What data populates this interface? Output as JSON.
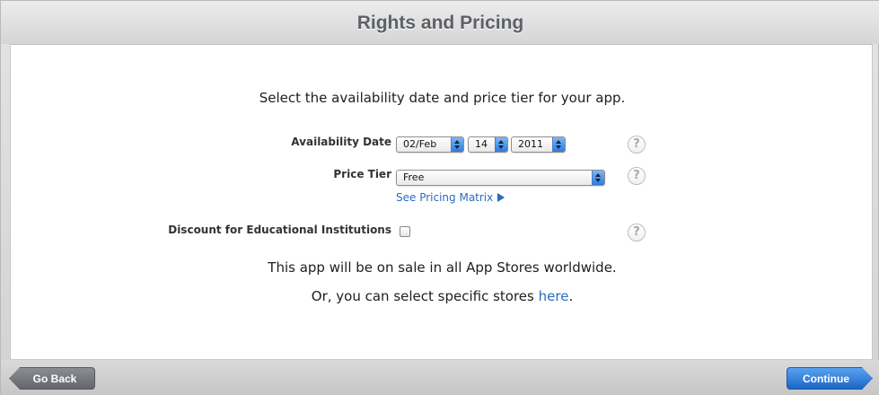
{
  "header": {
    "title": "Rights and Pricing"
  },
  "main": {
    "intro": "Select the availability date and price tier for your app.",
    "availability": {
      "label": "Availability Date",
      "month": "02/Feb",
      "day": "14",
      "year": "2011"
    },
    "price_tier": {
      "label": "Price Tier",
      "value": "Free",
      "matrix_link": "See Pricing Matrix"
    },
    "discount": {
      "label": "Discount for Educational Institutions",
      "checked": false
    },
    "help_glyph": "?",
    "sale_text": "This app will be on sale in all App Stores worldwide.",
    "stores_prefix": "Or, you can select specific stores ",
    "stores_link": "here",
    "stores_suffix": "."
  },
  "footer": {
    "back_label": "Go Back",
    "continue_label": "Continue"
  },
  "colors": {
    "link": "#2a6cc0",
    "continue_button": "#1a66c6",
    "back_button": "#62666c"
  },
  "icons": {
    "help": "question-mark-circle-icon",
    "select": "up-down-arrows-icon",
    "matrix": "right-triangle-icon"
  }
}
